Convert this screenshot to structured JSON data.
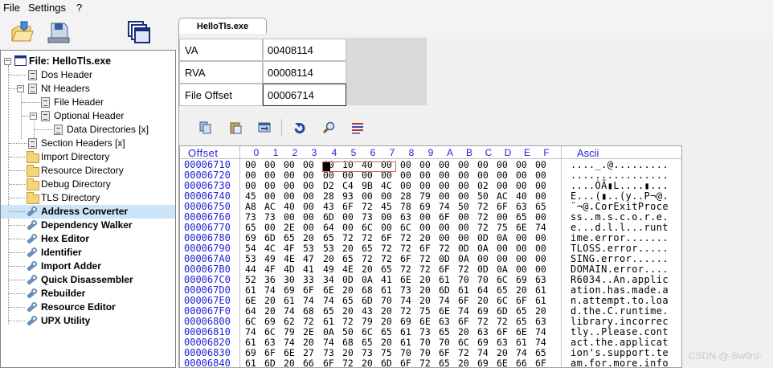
{
  "menu": {
    "items": [
      "File",
      "Settings",
      "?"
    ]
  },
  "toolbar": {
    "icons": [
      "open-file-icon",
      "save-drive-icon",
      "windows-icon"
    ]
  },
  "tree": {
    "root_label": "File: HelloTls.exe",
    "items": [
      {
        "label": "Dos Header"
      },
      {
        "label": "Nt Headers"
      },
      {
        "label": "File Header"
      },
      {
        "label": "Optional Header"
      },
      {
        "label": "Data Directories [x]"
      },
      {
        "label": "Section Headers [x]"
      },
      {
        "label": "Import Directory"
      },
      {
        "label": "Resource Directory"
      },
      {
        "label": "Debug Directory"
      },
      {
        "label": "TLS Directory"
      },
      {
        "label": "Address Converter"
      },
      {
        "label": "Dependency Walker"
      },
      {
        "label": "Hex Editor"
      },
      {
        "label": "Identifier"
      },
      {
        "label": "Import Adder"
      },
      {
        "label": "Quick Disassembler"
      },
      {
        "label": "Rebuilder"
      },
      {
        "label": "Resource Editor"
      },
      {
        "label": "UPX Utility"
      }
    ]
  },
  "tab": {
    "label": "HelloTls.exe"
  },
  "address": {
    "va_label": "VA",
    "va_value": "00408114",
    "rva_label": "RVA",
    "rva_value": "00008114",
    "offset_label": "File Offset",
    "offset_value": "00006714"
  },
  "hex": {
    "offset_header": "Offset",
    "ascii_header": "Ascii",
    "columns": [
      "0",
      "1",
      "2",
      "3",
      "4",
      "5",
      "6",
      "7",
      "8",
      "9",
      "A",
      "B",
      "C",
      "D",
      "E",
      "F"
    ],
    "rows": [
      {
        "offset": "00006710",
        "bytes": "00 00 00 00 00 10 40 00 00 00 00 00 00 00 00 00",
        "ascii": "...._.@........."
      },
      {
        "offset": "00006720",
        "bytes": "00 00 00 00 00 00 00 00 00 00 00 00 00 00 00 00",
        "ascii": "................"
      },
      {
        "offset": "00006730",
        "bytes": "00 00 00 00 D2 C4 9B 4C 00 00 00 00 02 00 00 00",
        "ascii": "....ÒÄ▮L....▮..."
      },
      {
        "offset": "00006740",
        "bytes": "45 00 00 00 28 93 00 00 28 79 00 00 50 AC 40 00",
        "ascii": "E...(▮..(y..P¬@."
      },
      {
        "offset": "00006750",
        "bytes": "A8 AC 40 00 43 6F 72 45 78 69 74 50 72 6F 63 65",
        "ascii": "¨¬@.CorExitProce"
      },
      {
        "offset": "00006760",
        "bytes": "73 73 00 00 6D 00 73 00 63 00 6F 00 72 00 65 00",
        "ascii": "ss..m.s.c.o.r.e."
      },
      {
        "offset": "00006770",
        "bytes": "65 00 2E 00 64 00 6C 00 6C 00 00 00 72 75 6E 74",
        "ascii": "e...d.l.l...runt"
      },
      {
        "offset": "00006780",
        "bytes": "69 6D 65 20 65 72 72 6F 72 20 00 00 0D 0A 00 00",
        "ascii": "ime.error......."
      },
      {
        "offset": "00006790",
        "bytes": "54 4C 4F 53 53 20 65 72 72 6F 72 0D 0A 00 00 00",
        "ascii": "TLOSS.error....."
      },
      {
        "offset": "000067A0",
        "bytes": "53 49 4E 47 20 65 72 72 6F 72 0D 0A 00 00 00 00",
        "ascii": "SING.error......"
      },
      {
        "offset": "000067B0",
        "bytes": "44 4F 4D 41 49 4E 20 65 72 72 6F 72 0D 0A 00 00",
        "ascii": "DOMAIN.error...."
      },
      {
        "offset": "000067C0",
        "bytes": "52 36 30 33 34 0D 0A 41 6E 20 61 70 70 6C 69 63",
        "ascii": "R6034..An.applic"
      },
      {
        "offset": "000067D0",
        "bytes": "61 74 69 6F 6E 20 68 61 73 20 6D 61 64 65 20 61",
        "ascii": "ation.has.made.a"
      },
      {
        "offset": "000067E0",
        "bytes": "6E 20 61 74 74 65 6D 70 74 20 74 6F 20 6C 6F 61",
        "ascii": "n.attempt.to.loa"
      },
      {
        "offset": "000067F0",
        "bytes": "64 20 74 68 65 20 43 20 72 75 6E 74 69 6D 65 20",
        "ascii": "d.the.C.runtime."
      },
      {
        "offset": "00006800",
        "bytes": "6C 69 62 72 61 72 79 20 69 6E 63 6F 72 72 65 63",
        "ascii": "library.incorrec"
      },
      {
        "offset": "00006810",
        "bytes": "74 6C 79 2E 0A 50 6C 65 61 73 65 20 63 6F 6E 74",
        "ascii": "tly..Please.cont"
      },
      {
        "offset": "00006820",
        "bytes": "61 63 74 20 74 68 65 20 61 70 70 6C 69 63 61 74",
        "ascii": "act.the.applicat"
      },
      {
        "offset": "00006830",
        "bytes": "69 6F 6E 27 73 20 73 75 70 70 6F 72 74 20 74 65",
        "ascii": "ion's.support.te"
      },
      {
        "offset": "00006840",
        "bytes": "61 6D 20 66 6F 72 20 6D 6F 72 65 20 69 6E 66 6F",
        "ascii": "am.for.more.info"
      }
    ]
  },
  "watermark": "CSDN @-Sw0rd-"
}
